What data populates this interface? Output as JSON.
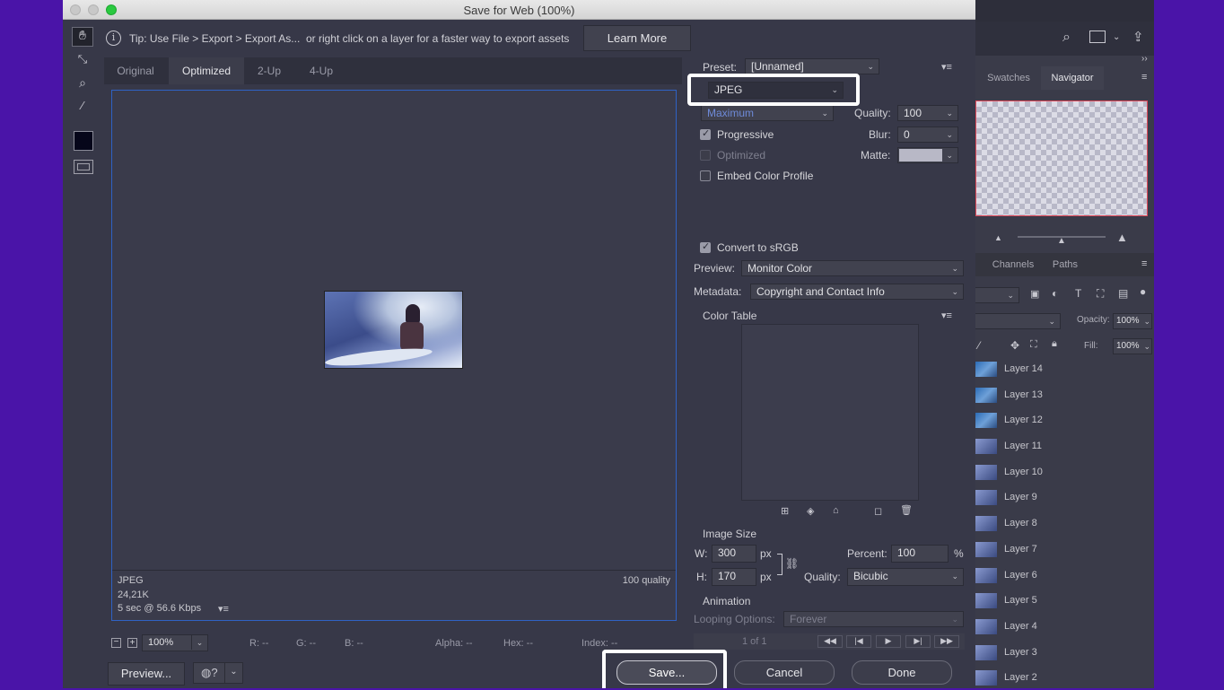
{
  "window": {
    "title": "Save for Web (100%)"
  },
  "tip": {
    "text": "Tip: Use File > Export > Export As...  or right click on a layer for a faster way to export assets",
    "learn_more": "Learn More"
  },
  "tabs": [
    "Original",
    "Optimized",
    "2-Up",
    "4-Up"
  ],
  "preview_info": {
    "format": "JPEG",
    "size": "24,21K",
    "time": "5 sec @ 56.6 Kbps",
    "quality": "100 quality"
  },
  "status": {
    "zoom": "100%",
    "r": "R: --",
    "g": "G: --",
    "b": "B: --",
    "alpha": "Alpha: --",
    "hex": "Hex: --",
    "index": "Index: --"
  },
  "settings": {
    "preset_label": "Preset:",
    "preset_value": "[Unnamed]",
    "format": "JPEG",
    "compression": "Maximum",
    "quality_label": "Quality:",
    "quality_value": "100",
    "progressive": "Progressive",
    "blur_label": "Blur:",
    "blur_value": "0",
    "optimized": "Optimized",
    "matte_label": "Matte:",
    "embed": "Embed Color Profile",
    "convert": "Convert to sRGB",
    "preview_label": "Preview:",
    "preview_value": "Monitor Color",
    "metadata_label": "Metadata:",
    "metadata_value": "Copyright and Contact Info",
    "color_table": "Color Table",
    "image_size": "Image Size",
    "w_label": "W:",
    "w_value": "300",
    "h_label": "H:",
    "h_value": "170",
    "px": "px",
    "percent_label": "Percent:",
    "percent_value": "100",
    "percent_sign": "%",
    "resample_label": "Quality:",
    "resample_value": "Bicubic",
    "animation": "Animation",
    "looping_label": "Looping Options:",
    "looping_value": "Forever",
    "frame": "1 of 1"
  },
  "buttons": {
    "preview": "Preview...",
    "save": "Save...",
    "cancel": "Cancel",
    "done": "Done"
  },
  "right_panel": {
    "tabs_top": [
      "Swatches",
      "Navigator"
    ],
    "tabs_mid": [
      "Channels",
      "Paths"
    ],
    "opacity_label": "Opacity:",
    "opacity_value": "100%",
    "fill_label": "Fill:",
    "fill_value": "100%",
    "layers": [
      "Layer 14",
      "Layer 13",
      "Layer 12",
      "Layer 11",
      "Layer 10",
      "Layer 9",
      "Layer 8",
      "Layer 7",
      "Layer 6",
      "Layer 5",
      "Layer 4",
      "Layer 3",
      "Layer 2"
    ]
  },
  "colors": {
    "dialog_bg": "#373848",
    "desktop": "#4a14a8",
    "highlight": "#ffffff",
    "preview_border": "#2f62c4"
  }
}
